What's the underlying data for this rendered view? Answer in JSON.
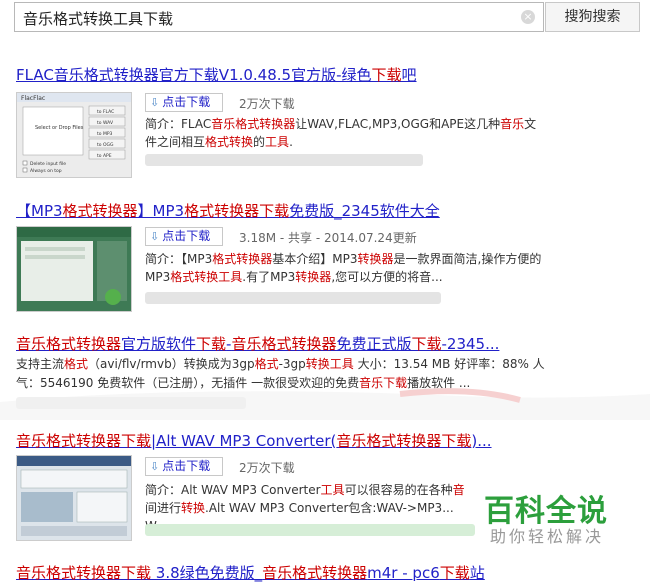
{
  "search": {
    "query": "音乐格式转换工具下载",
    "clear_icon": "×",
    "button_label": "搜狗搜索"
  },
  "results": [
    {
      "title_parts": [
        {
          "t": "FLAC音乐格式转换器官方下载V1.0.48.5官方版-绿色",
          "hl": false
        },
        {
          "t": "下载",
          "hl": true
        },
        {
          "t": "吧",
          "hl": false
        }
      ],
      "download_label": "点击下载",
      "meta": "2万次下载",
      "desc_parts": [
        {
          "t": "简介：FLAC",
          "hl": false
        },
        {
          "t": "音乐格式转换器",
          "hl": true
        },
        {
          "t": "让WAV,FLAC,MP3,OGG和APE这几种",
          "hl": false
        },
        {
          "t": "音乐",
          "hl": true
        },
        {
          "t": "文件之间相互",
          "hl": false
        },
        {
          "t": "格式转换",
          "hl": true
        },
        {
          "t": "的",
          "hl": false
        },
        {
          "t": "工具",
          "hl": true
        },
        {
          "t": ".",
          "hl": false
        }
      ],
      "thumb": {
        "app_name": "FlacFlac",
        "drop_text": "Select or Drop Files",
        "buttons": [
          "to FLAC",
          "to WAV",
          "to MP3",
          "to OGG",
          "to APE"
        ],
        "checks": [
          "Delete input file",
          "Always on top"
        ]
      }
    },
    {
      "title_parts": [
        {
          "t": "【MP3",
          "hl": false
        },
        {
          "t": "格式转换器",
          "hl": true
        },
        {
          "t": "】MP3",
          "hl": false
        },
        {
          "t": "格式转换器下载",
          "hl": true
        },
        {
          "t": "免费版_2345软件大全",
          "hl": false
        }
      ],
      "download_label": "点击下载",
      "meta": "3.18M - 共享 - 2014.07.24更新",
      "desc_parts": [
        {
          "t": "简介：【MP3",
          "hl": false
        },
        {
          "t": "格式转换器",
          "hl": true
        },
        {
          "t": "基本介绍】MP3",
          "hl": false
        },
        {
          "t": "转换器",
          "hl": true
        },
        {
          "t": "是一款界面简洁,操作方便的MP3",
          "hl": false
        },
        {
          "t": "格式转换工具",
          "hl": true
        },
        {
          "t": ".有了MP3",
          "hl": false
        },
        {
          "t": "转换器",
          "hl": true
        },
        {
          "t": ",您可以方便的将音...",
          "hl": false
        }
      ]
    },
    {
      "title_parts": [
        {
          "t": "音乐格式转换器",
          "hl": true
        },
        {
          "t": "官方版软件",
          "hl": false
        },
        {
          "t": "下载",
          "hl": true
        },
        {
          "t": "-",
          "hl": false
        },
        {
          "t": "音乐格式转换器",
          "hl": true
        },
        {
          "t": "免费正式版",
          "hl": false
        },
        {
          "t": "下载",
          "hl": true
        },
        {
          "t": "-2345...",
          "hl": false
        }
      ],
      "desc_parts": [
        {
          "t": "支持主流",
          "hl": false
        },
        {
          "t": "格式",
          "hl": true
        },
        {
          "t": "（avi/flv/rmvb）转换成为3gp",
          "hl": false
        },
        {
          "t": "格式",
          "hl": true
        },
        {
          "t": "-3gp",
          "hl": false
        },
        {
          "t": "转换工具",
          "hl": true
        },
        {
          "t": " 大小：13.54 MB 好评率：88% 人气：5546190 免费软件（已注册），无插件 一款很受欢迎的免费",
          "hl": false
        },
        {
          "t": "音乐下载",
          "hl": true
        },
        {
          "t": "播放软件 ...",
          "hl": false
        }
      ]
    },
    {
      "title_parts": [
        {
          "t": "音乐格式转换器下载",
          "hl": true
        },
        {
          "t": "|Alt WAV MP3 Converter(",
          "hl": false
        },
        {
          "t": "音乐格式转换器下载",
          "hl": true
        },
        {
          "t": ")...",
          "hl": false
        }
      ],
      "download_label": "点击下载",
      "meta": "2万次下载",
      "desc_parts": [
        {
          "t": "简介：Alt WAV MP3 Converter",
          "hl": false
        },
        {
          "t": "工具",
          "hl": true
        },
        {
          "t": "可以很容易的在各种",
          "hl": false
        },
        {
          "t": "音",
          "hl": true
        },
        {
          "t": " 间进行",
          "hl": false
        },
        {
          "t": "转换",
          "hl": true
        },
        {
          "t": ".Alt WAV MP3 Converter包含:WAV->MP3... W",
          "hl": false
        }
      ]
    },
    {
      "title_parts": [
        {
          "t": "音乐格式转换器下载",
          "hl": true
        },
        {
          "t": " 3.8绿色免费版_",
          "hl": false
        },
        {
          "t": "音乐格式转换器",
          "hl": true
        },
        {
          "t": "m4r - pc6",
          "hl": false
        },
        {
          "t": "下载",
          "hl": true
        },
        {
          "t": "站",
          "hl": false
        }
      ]
    }
  ],
  "watermark": {
    "title": "百科全说",
    "subtitle": "助你轻松解决"
  }
}
